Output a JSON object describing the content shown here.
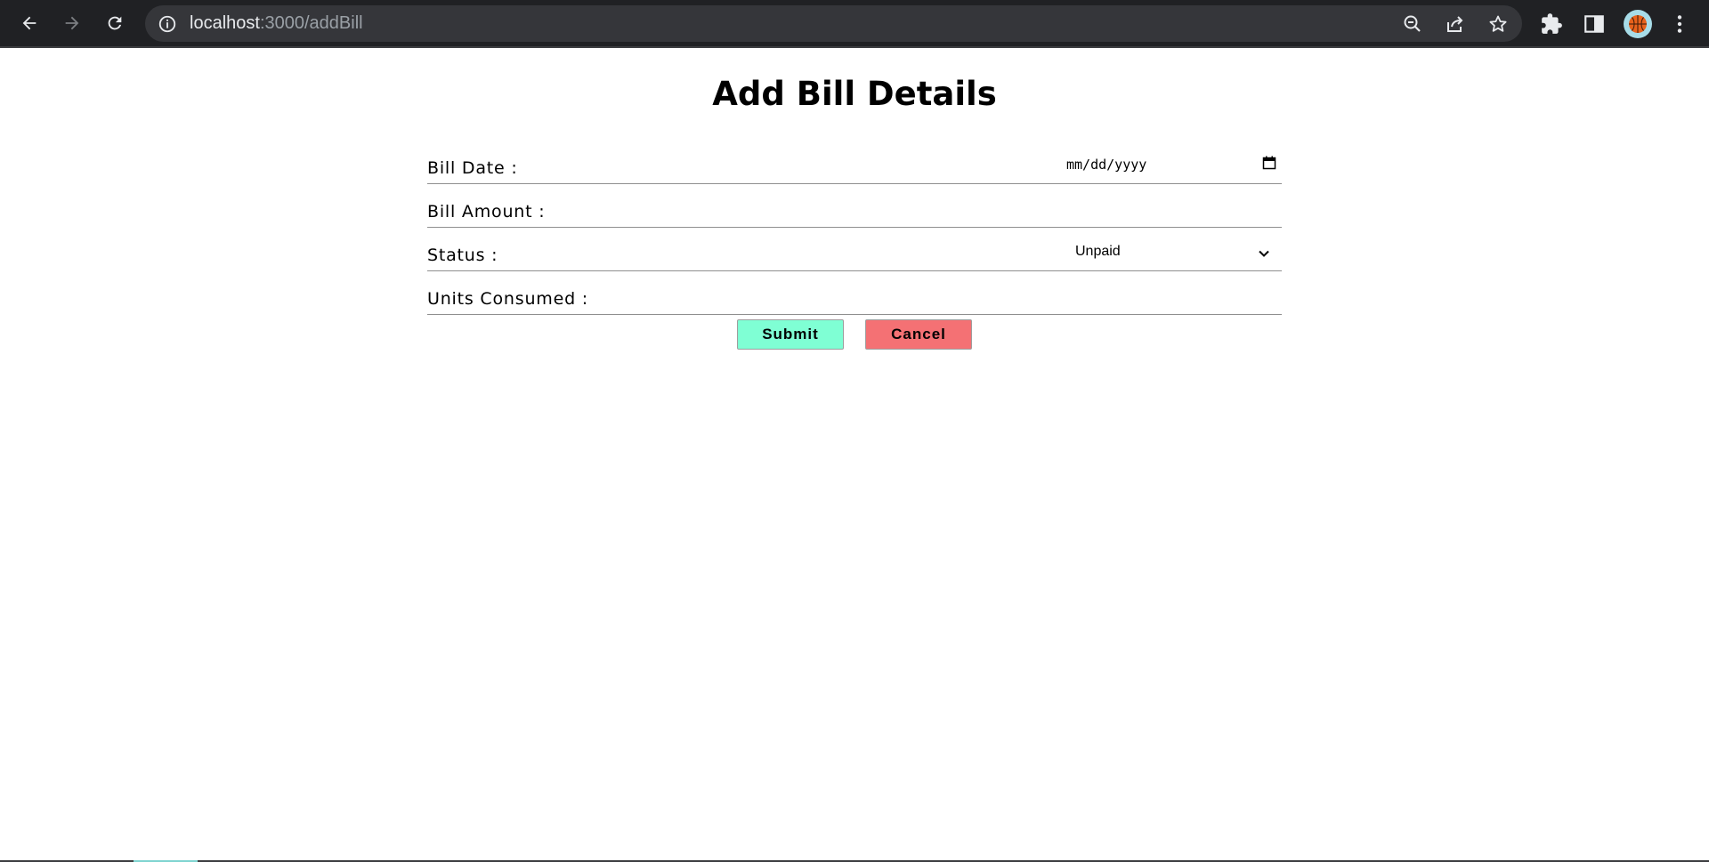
{
  "browser": {
    "url_host": "localhost",
    "url_path": ":3000/addBill",
    "icons": [
      "back-icon",
      "forward-icon",
      "reload-icon",
      "info-icon",
      "zoom-out-icon",
      "share-icon",
      "star-icon",
      "extensions-icon",
      "side-panel-icon",
      "menu-icon"
    ]
  },
  "page": {
    "title": "Add Bill Details"
  },
  "form": {
    "bill_date": {
      "label": "Bill Date :",
      "placeholder": "mm/dd/yyyy"
    },
    "bill_amount": {
      "label": "Bill Amount :",
      "value": ""
    },
    "status": {
      "label": "Status :",
      "value": "Unpaid"
    },
    "units_consumed": {
      "label": "Units Consumed :",
      "value": ""
    }
  },
  "actions": {
    "submit_label": "Submit",
    "cancel_label": "Cancel"
  },
  "colors": {
    "submit_bg": "#7fffd4",
    "cancel_bg": "#f47174",
    "chrome_bg": "#202124"
  }
}
